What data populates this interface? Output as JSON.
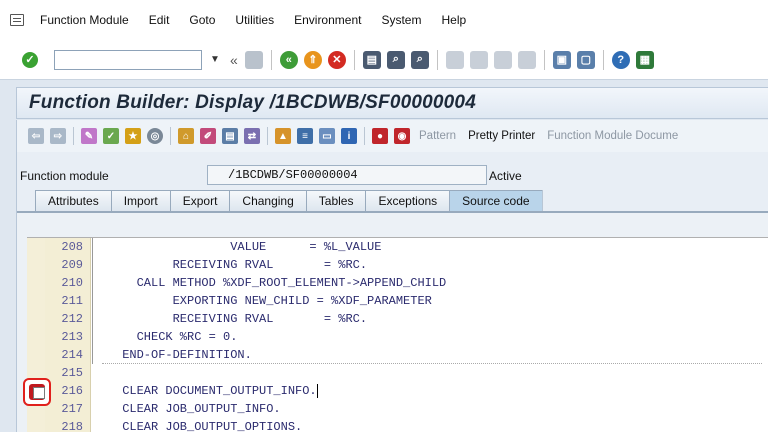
{
  "menubar": {
    "items": [
      "Function Module",
      "Edit",
      "Goto",
      "Utilities",
      "Environment",
      "System",
      "Help"
    ]
  },
  "std_toolbar": {
    "command_value": "",
    "icons": [
      "ok-icon",
      "save-icon",
      "back-icon",
      "exit-icon",
      "cancel-icon",
      "print-icon",
      "find-icon",
      "find-next-icon",
      "first-page-icon",
      "prev-page-icon",
      "next-page-icon",
      "last-page-icon",
      "new-session-icon",
      "shortcut-icon",
      "help-icon",
      "layout-icon"
    ]
  },
  "title": "Function Builder: Display /1BCDWB/SF00000004",
  "app_toolbar": {
    "pattern_label": "Pattern",
    "pretty_printer_label": "Pretty Printer",
    "fm_doc_label": "Function Module Docume"
  },
  "header": {
    "fm_label": "Function module",
    "fm_value": "/1BCDWB/SF00000004",
    "status": "Active"
  },
  "tabs": [
    {
      "label": "Attributes"
    },
    {
      "label": "Import"
    },
    {
      "label": "Export"
    },
    {
      "label": "Changing"
    },
    {
      "label": "Tables"
    },
    {
      "label": "Exceptions"
    },
    {
      "label": "Source code",
      "active": true
    }
  ],
  "code": [
    {
      "num": "208",
      "text": "                VALUE      = %L_VALUE"
    },
    {
      "num": "209",
      "text": "        RECEIVING RVAL       = %RC."
    },
    {
      "num": "210",
      "text": "   CALL METHOD %XDF_ROOT_ELEMENT->APPEND_CHILD"
    },
    {
      "num": "211",
      "text": "        EXPORTING NEW_CHILD = %XDF_PARAMETER"
    },
    {
      "num": "212",
      "text": "        RECEIVING RVAL       = %RC."
    },
    {
      "num": "213",
      "text": "   CHECK %RC = 0."
    },
    {
      "num": "214",
      "text": " END-OF-DEFINITION."
    },
    {
      "num": "215",
      "text": ""
    },
    {
      "num": "216",
      "text": " CLEAR DOCUMENT_OUTPUT_INFO."
    },
    {
      "num": "217",
      "text": " CLEAR JOB_OUTPUT_INFO."
    },
    {
      "num": "218",
      "text": " CLEAR JOB_OUTPUT_OPTIONS."
    }
  ]
}
